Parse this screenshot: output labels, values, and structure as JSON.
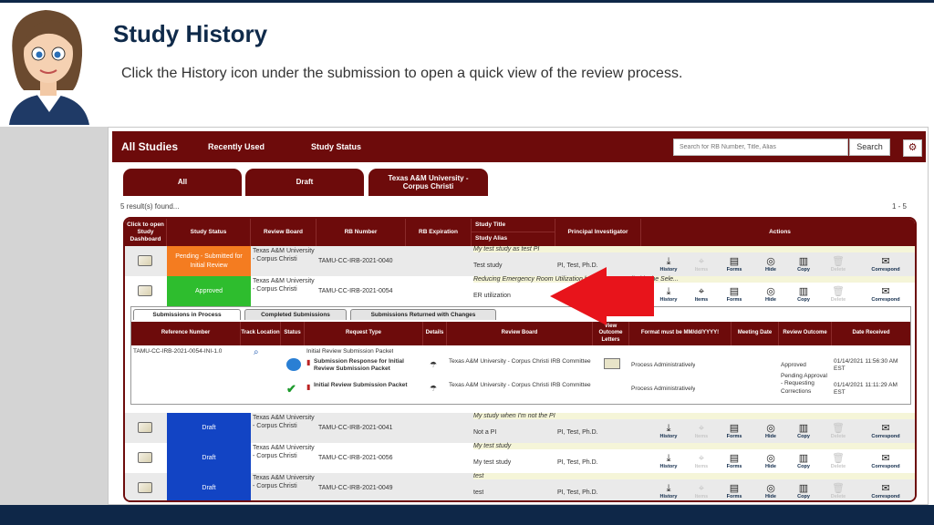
{
  "slide": {
    "title": "Study History",
    "subtitle": "Click the History icon under the submission to open a quick view of the review process."
  },
  "app": {
    "nav": [
      "All Studies",
      "Recently Used",
      "Study Status"
    ],
    "search_placeholder": "Search for RB Number, Title, Alias",
    "search_button": "Search",
    "settings_icon": "gear-icon",
    "filter_tabs": [
      {
        "label": "All"
      },
      {
        "label": "Draft"
      },
      {
        "line1": "Texas A&M University -",
        "line2": "Corpus Christi"
      }
    ],
    "results_text": "5 result(s) found...",
    "pager_text": "1 - 5",
    "columns": {
      "dashboard": "Click to open Study Dashboard",
      "status": "Study Status",
      "board": "Review Board",
      "rb": "RB Number",
      "expiration": "RB Expiration",
      "title": "Study Title",
      "alias": "Study Alias",
      "pi": "Principal Investigator",
      "actions": "Actions"
    },
    "action_labels": [
      "History",
      "Items",
      "Forms",
      "Hide",
      "Copy",
      "Delete",
      "Correspond"
    ],
    "rows": [
      {
        "status": "Pending - Submitted for Initial Review",
        "board": "Texas A&M University - Corpus Christi",
        "rb": "TAMU-CC-IRB-2021-0040",
        "title": "My test study as test PI",
        "alias": "Test study",
        "pi": "PI, Test, Ph.D."
      },
      {
        "status": "Approved",
        "board": "Texas A&M University - Corpus Christi",
        "rb": "TAMU-CC-IRB-2021-0054",
        "title": "Reducing Emergency Room Utilization by Patients Enrolled in the Sele...",
        "alias": "ER utilization",
        "pi": ""
      },
      {
        "status": "Draft",
        "board": "Texas A&M University - Corpus Christi",
        "rb": "TAMU-CC-IRB-2021-0041",
        "title": "My study when I'm not the PI",
        "alias": "Not a PI",
        "pi": "PI, Test, Ph.D."
      },
      {
        "status": "Draft",
        "board": "Texas A&M University - Corpus Christi",
        "rb": "TAMU-CC-IRB-2021-0056",
        "title": "My test study",
        "alias": "My test study",
        "pi": "PI, Test, Ph.D."
      },
      {
        "status": "Draft",
        "board": "Texas A&M University - Corpus Christi",
        "rb": "TAMU-CC-IRB-2021-0049",
        "title": "test",
        "alias": "test",
        "pi": "PI, Test, Ph.D."
      }
    ],
    "colors": {
      "brand": "#6d0b0b",
      "pending": "#f47c20",
      "approved": "#2ebd2e",
      "draft": "#1244c4",
      "arrow": "#e8141b"
    },
    "submissions": {
      "tabs": [
        "Submissions in Process",
        "Completed Submissions",
        "Submissions Returned with Changes"
      ],
      "headers": {
        "ref": "Reference Number",
        "track": "Track Location",
        "status": "Status",
        "type": "Request Type",
        "details": "Details",
        "board": "Review Board",
        "letters": "View Outcome Letters",
        "format": "Format must be MM/dd/YYYY!",
        "meeting": "Meeting Date",
        "outcome": "Review Outcome",
        "received": "Date Received"
      },
      "parent": {
        "ref": "TAMU-CC-IRB-2021-0054-INI-1.0",
        "type": "Initial Review Submission Packet"
      },
      "items": [
        {
          "type": "Submission Response for Initial Review Submission Packet",
          "board": "Texas A&M University - Corpus Christi IRB Committee",
          "format": "Process Administratively",
          "outcome": "Approved",
          "received": "01/14/2021 11:56:30 AM EST"
        },
        {
          "type": "Initial Review Submission Packet",
          "board": "Texas A&M University - Corpus Christi IRB Committee",
          "format": "Process Administratively",
          "outcome": "Pending Approval - Requesting Corrections",
          "received": "01/14/2021 11:11:29 AM EST"
        }
      ]
    }
  }
}
